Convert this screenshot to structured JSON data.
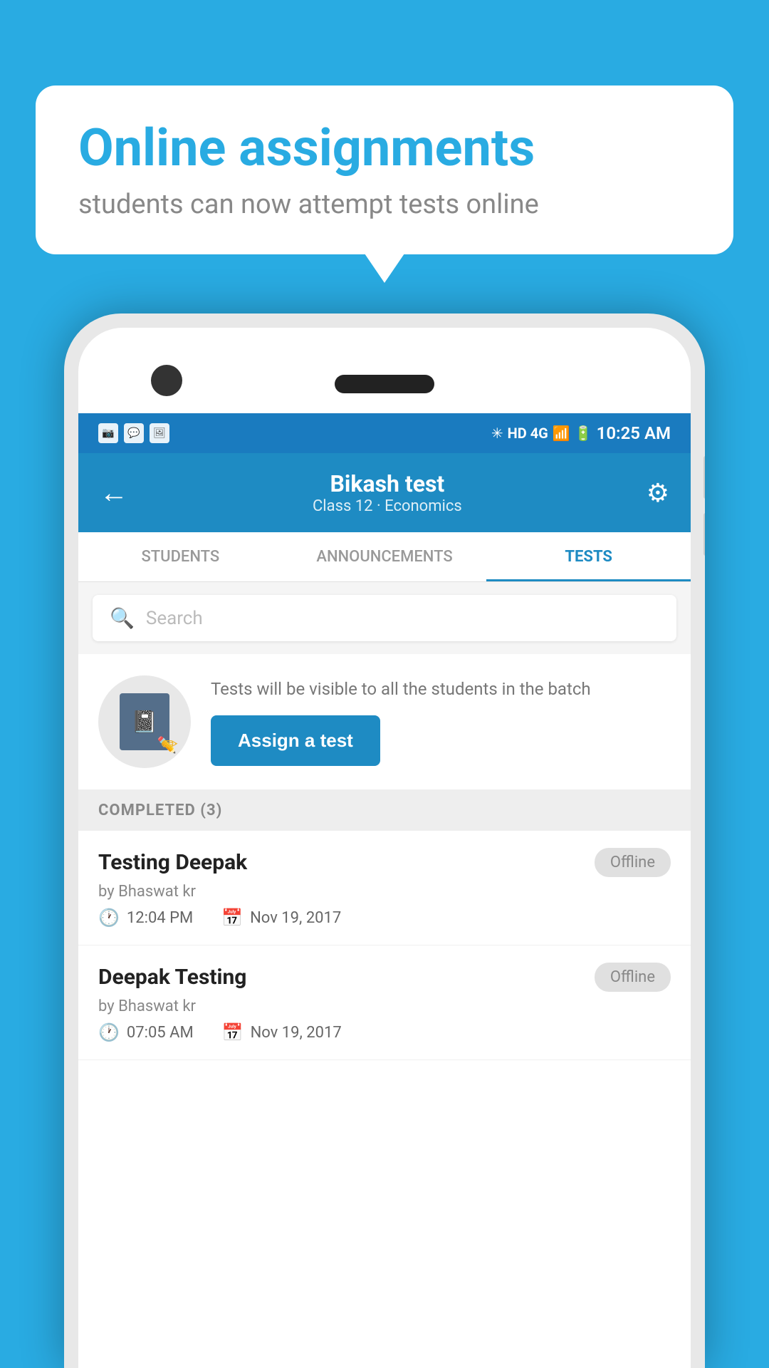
{
  "page": {
    "background_color": "#29abe2"
  },
  "speech_bubble": {
    "title": "Online assignments",
    "subtitle": "students can now attempt tests online"
  },
  "status_bar": {
    "time": "10:25 AM",
    "network": "HD 4G"
  },
  "header": {
    "title": "Bikash test",
    "subtitle": "Class 12 · Economics",
    "back_label": "←",
    "settings_label": "⚙"
  },
  "tabs": [
    {
      "label": "STUDENTS",
      "active": false
    },
    {
      "label": "ANNOUNCEMENTS",
      "active": false
    },
    {
      "label": "TESTS",
      "active": true
    }
  ],
  "search": {
    "placeholder": "Search"
  },
  "assign_section": {
    "description": "Tests will be visible to all the students in the batch",
    "button_label": "Assign a test"
  },
  "completed_section": {
    "label": "COMPLETED (3)"
  },
  "test_items": [
    {
      "name": "Testing Deepak",
      "author": "by Bhaswat kr",
      "time": "12:04 PM",
      "date": "Nov 19, 2017",
      "status": "Offline"
    },
    {
      "name": "Deepak Testing",
      "author": "by Bhaswat kr",
      "time": "07:05 AM",
      "date": "Nov 19, 2017",
      "status": "Offline"
    }
  ]
}
